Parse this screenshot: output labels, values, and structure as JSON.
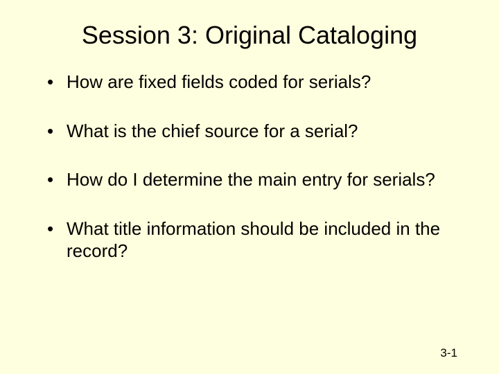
{
  "title": "Session 3: Original Cataloging",
  "bullets": [
    "How are fixed fields coded for serials?",
    "What is the chief source for a serial?",
    "How do I determine the main entry for serials?",
    "What title information should be included in the record?"
  ],
  "footer": "3-1"
}
